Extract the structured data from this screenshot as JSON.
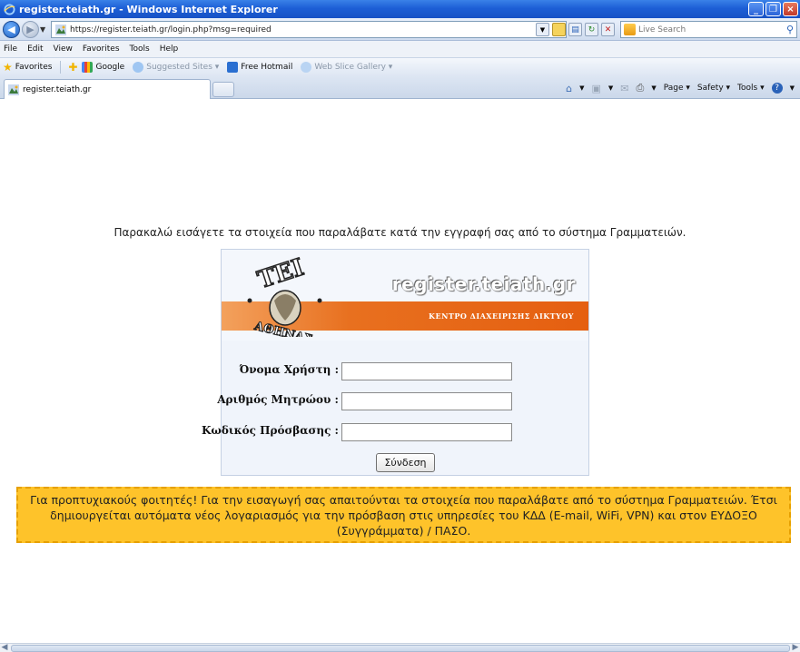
{
  "window": {
    "title": "register.teiath.gr - Windows Internet Explorer",
    "controls": [
      "_",
      "❐",
      "×"
    ]
  },
  "address_bar": {
    "url": "https://register.teiath.gr/login.php?msg=required",
    "search_placeholder": "Live Search"
  },
  "menu": [
    "File",
    "Edit",
    "View",
    "Favorites",
    "Tools",
    "Help"
  ],
  "favorites_bar": {
    "favorites_label": "Favorites",
    "items": [
      "Google",
      "Suggested Sites ▾",
      "Free Hotmail",
      "Web Slice Gallery ▾"
    ]
  },
  "tab": {
    "title": "register.teiath.gr"
  },
  "command_bar": {
    "page": "Page ▾",
    "safety": "Safety ▾",
    "tools": "Tools ▾"
  },
  "page": {
    "instruction": "Παρακαλώ εισάγετε τα στοιχεία που παραλάβατε κατά την εγγραφή σας από το σύστημα Γραμματειών.",
    "brand": "register.teiath.gr",
    "brand_sub": "ΚΕΝΤΡΟ ΔΙΑΧΕΙΡΙΣΗΣ ΔΙΚΤΥΟΥ",
    "logo_text_top": "ΤΕΙ",
    "logo_text_bottom": "ΑΘΗΝΑΣ",
    "fields": [
      {
        "label": "Όνομα Χρήστη :",
        "value": ""
      },
      {
        "label": "Αριθμός Μητρώου :",
        "value": ""
      },
      {
        "label": "Κωδικός Πρόσβασης :",
        "value": ""
      }
    ],
    "submit_label": "Σύνδεση",
    "notice": "Για προπτυχιακούς φοιτητές! Για την εισαγωγή σας απαιτούνται τα στοιχεία που παραλάβατε από το σύστημα Γραμματειών. Έτσι δημιουργείται αυτόματα νέος λογαριασμός για την πρόσβαση στις υπηρεσίες του ΚΔΔ (E-mail, WiFi, VPN) και στον ΕΥΔΟΞΟ (Συγγράμματα) / ΠΑΣΟ."
  },
  "colors": {
    "titlebar": "#1d5fd6",
    "banner_orange": "#e8701f",
    "notice_bg": "#fec32a",
    "notice_border": "#e6a000"
  }
}
